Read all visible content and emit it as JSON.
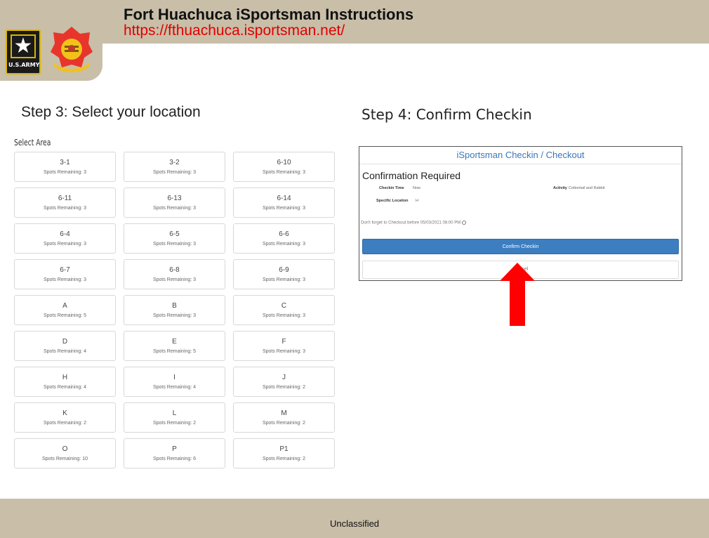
{
  "header": {
    "title": "Fort Huachuca iSportsman Instructions",
    "url": "https://fthuachuca.isportsman.net/",
    "army_logo_text": "U.S.ARMY"
  },
  "step3": {
    "heading": "Step 3: Select your location",
    "select_area_label": "Select Area",
    "areas": [
      {
        "name": "3-1",
        "spots": "Spots Remaining: 3"
      },
      {
        "name": "3-2",
        "spots": "Spots Remaining: 3"
      },
      {
        "name": "6-10",
        "spots": "Spots Remaining: 3"
      },
      {
        "name": "6-11",
        "spots": "Spots Remaining: 3"
      },
      {
        "name": "6-13",
        "spots": "Spots Remaining: 3"
      },
      {
        "name": "6-14",
        "spots": "Spots Remaining: 3"
      },
      {
        "name": "6-4",
        "spots": "Spots Remaining: 3"
      },
      {
        "name": "6-5",
        "spots": "Spots Remaining: 3"
      },
      {
        "name": "6-6",
        "spots": "Spots Remaining: 3"
      },
      {
        "name": "6-7",
        "spots": "Spots Remaining: 3"
      },
      {
        "name": "6-8",
        "spots": "Spots Remaining: 3"
      },
      {
        "name": "6-9",
        "spots": "Spots Remaining: 3"
      },
      {
        "name": "A",
        "spots": "Spots Remaining: 5"
      },
      {
        "name": "B",
        "spots": "Spots Remaining: 3"
      },
      {
        "name": "C",
        "spots": "Spots Remaining: 3"
      },
      {
        "name": "D",
        "spots": "Spots Remaining: 4"
      },
      {
        "name": "E",
        "spots": "Spots Remaining: 5"
      },
      {
        "name": "F",
        "spots": "Spots Remaining: 3"
      },
      {
        "name": "H",
        "spots": "Spots Remaining: 4"
      },
      {
        "name": "I",
        "spots": "Spots Remaining: 4"
      },
      {
        "name": "J",
        "spots": "Spots Remaining: 2"
      },
      {
        "name": "K",
        "spots": "Spots Remaining: 2"
      },
      {
        "name": "L",
        "spots": "Spots Remaining: 2"
      },
      {
        "name": "M",
        "spots": "Spots Remaining: 2"
      },
      {
        "name": "O",
        "spots": "Spots Remaining: 10"
      },
      {
        "name": "P",
        "spots": "Spots Remaining: 6"
      },
      {
        "name": "P1",
        "spots": "Spots Remaining: 2"
      }
    ]
  },
  "step4": {
    "heading": "Step 4: Confirm Checkin",
    "panel_title": "iSportsman Checkin / Checkout",
    "confirm_heading": "Confirmation Required",
    "checkin_time_label": "Checkin Time",
    "checkin_time_value": "Now",
    "activity_label": "Activity",
    "activity_value": "Cottontail and Rabbit",
    "specific_location_label": "Specific Location",
    "specific_location_value": "H",
    "reminder": "Don't forget to Checkout before 05/03/2021 08:00 PM",
    "confirm_button": "Confirm Checkin",
    "cancel_button": "Cancel"
  },
  "footer": {
    "classification": "Unclassified"
  },
  "colors": {
    "band": "#c9bea8",
    "url_red": "#e00000",
    "panel_blue": "#3a78b8",
    "button_blue": "#3c7ec0",
    "arrow_red": "#ff0000"
  }
}
